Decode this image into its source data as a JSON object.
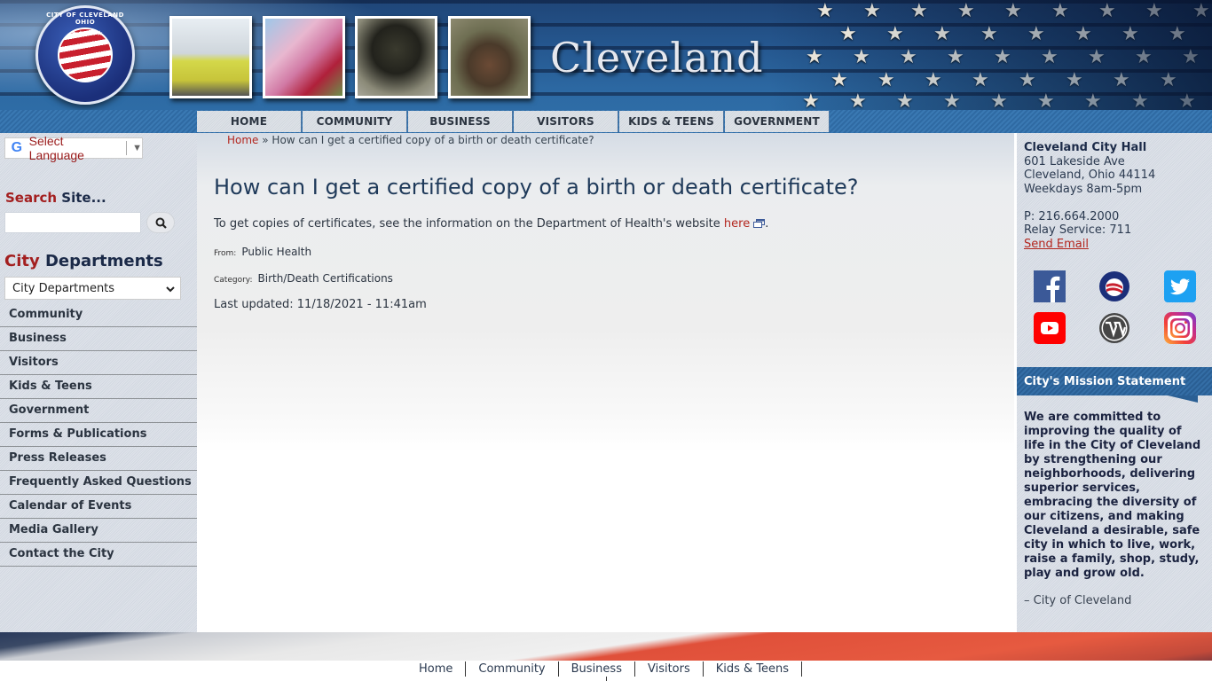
{
  "header": {
    "site_title": "Cleveland",
    "seal_text": "CITY OF CLEVELAND OHIO",
    "seal_stars": "★★★★★",
    "photos": [
      "ambulance-photo",
      "free-stamp-photo",
      "firefighter-ladder-photo",
      "firefighter-portrait-photo"
    ],
    "star_glyph": "★"
  },
  "top_nav": [
    {
      "label": "HOME"
    },
    {
      "label": "COMMUNITY"
    },
    {
      "label": "BUSINESS"
    },
    {
      "label": "VISITORS"
    },
    {
      "label": "KIDS & TEENS"
    },
    {
      "label": "GOVERNMENT"
    }
  ],
  "left_sidebar": {
    "translate": {
      "g_glyph": "G",
      "label": "Select Language",
      "arrow": "▼"
    },
    "search": {
      "accent": "Search",
      "rest": " Site...",
      "value": "",
      "placeholder": "",
      "icon": "search-icon"
    },
    "departments": {
      "accent": "City",
      "rest": " Departments",
      "selected": "City Departments",
      "chevron": "⌄"
    },
    "nav": [
      {
        "label": "Community"
      },
      {
        "label": "Business"
      },
      {
        "label": "Visitors"
      },
      {
        "label": "Kids & Teens"
      },
      {
        "label": "Government"
      },
      {
        "label": "Forms & Publications"
      },
      {
        "label": "Press Releases"
      },
      {
        "label": "Frequently Asked Questions"
      },
      {
        "label": "Calendar of Events"
      },
      {
        "label": "Media Gallery"
      },
      {
        "label": "Contact the City"
      }
    ]
  },
  "main": {
    "breadcrumb": {
      "home": "Home",
      "sep": " » ",
      "current": "How can I get a certified copy of a birth or death certificate?"
    },
    "title": "How can I get a certified copy of a birth or death certificate?",
    "body_prefix": "To get copies of certificates, see the information on the Department of Health's website ",
    "body_link": "here",
    "body_suffix": ".",
    "from_label": "From:",
    "from_value": "Public Health",
    "category_label": "Category:",
    "category_value": "Birth/Death Certifications",
    "updated": "Last updated: 11/18/2021 - 11:41am"
  },
  "right_sidebar": {
    "contact": {
      "name": "Cleveland City Hall",
      "address1": "601 Lakeside Ave",
      "address2": "Cleveland, Ohio 44114",
      "hours": "Weekdays 8am-5pm",
      "phone": "P: 216.664.2000",
      "relay": "Relay Service: 711",
      "email_link": "Send Email"
    },
    "socials": [
      "facebook",
      "city-seal",
      "twitter",
      "youtube",
      "wordpress",
      "instagram"
    ],
    "mission": {
      "heading": "City's Mission Statement",
      "text": "We are committed to improving the quality of life in the City of Cleveland by strengthening our neighborhoods, delivering superior services, embracing the diversity of our citizens, and making Cleveland a desirable, safe city in which to live, work, raise a family, shop, study, play and grow old.",
      "signature": "– City of Cleveland"
    }
  },
  "footer": {
    "nav": [
      {
        "label": "Home"
      },
      {
        "label": "Community"
      },
      {
        "label": "Business"
      },
      {
        "label": "Visitors"
      },
      {
        "label": "Kids & Teens"
      }
    ]
  },
  "colors": {
    "accent_red": "#b3261e",
    "navy": "#1b2a48",
    "header_blue": "#25578f"
  }
}
